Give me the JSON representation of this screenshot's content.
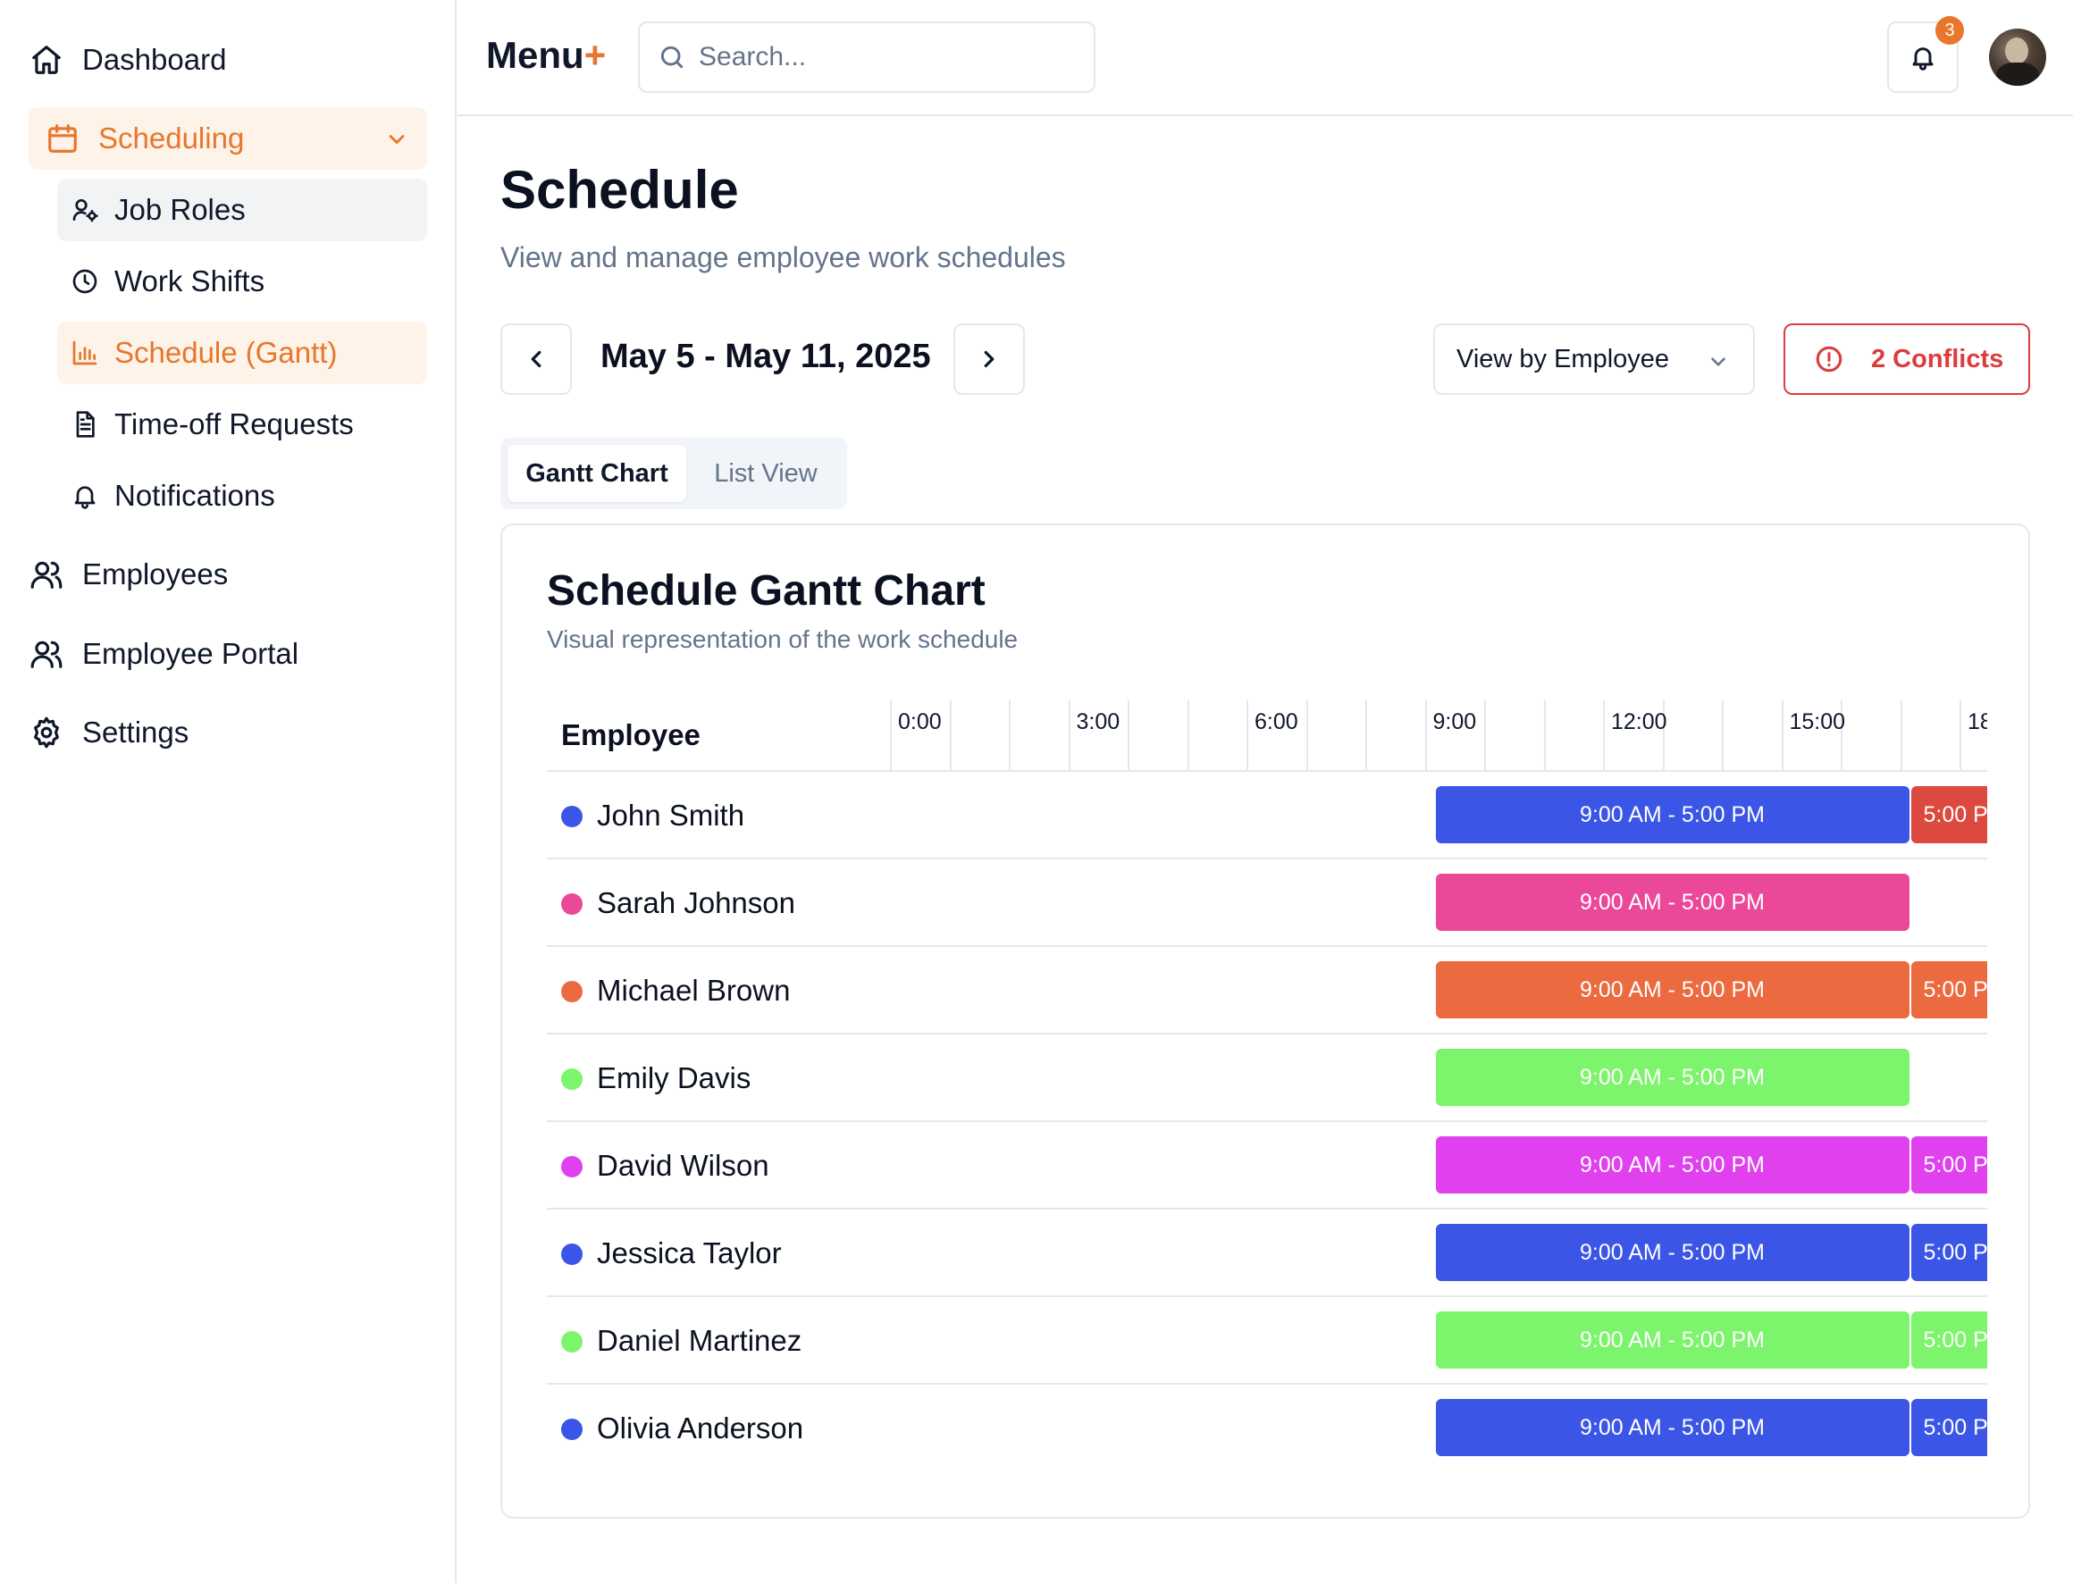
{
  "sidebar": {
    "items": [
      {
        "label": "Dashboard",
        "icon": "home-icon"
      },
      {
        "label": "Scheduling",
        "icon": "calendar-icon"
      },
      {
        "label": "Job Roles",
        "icon": "user-cog-icon"
      },
      {
        "label": "Work Shifts",
        "icon": "clock-icon"
      },
      {
        "label": "Schedule (Gantt)",
        "icon": "bar-chart-icon"
      },
      {
        "label": "Time-off Requests",
        "icon": "document-icon"
      },
      {
        "label": "Notifications",
        "icon": "bell-icon"
      },
      {
        "label": "Employees",
        "icon": "users-icon"
      },
      {
        "label": "Employee Portal",
        "icon": "users-icon"
      },
      {
        "label": "Settings",
        "icon": "gear-icon"
      }
    ]
  },
  "header": {
    "logo_text": "Menu",
    "logo_plus": "+",
    "search_placeholder": "Search...",
    "notification_count": "3"
  },
  "main": {
    "title": "Schedule",
    "subtitle": "View and manage employee work schedules",
    "date_range": "May 5 - May 11, 2025",
    "view_select": "View by Employee",
    "conflicts_label": "2 Conflicts",
    "tabs": [
      {
        "label": "Gantt Chart",
        "active": true
      },
      {
        "label": "List View",
        "active": false
      }
    ]
  },
  "gantt": {
    "title": "Schedule Gantt Chart",
    "subtitle": "Visual representation of the work schedule",
    "employee_header": "Employee",
    "hour_labels": [
      "0:00",
      "3:00",
      "6:00",
      "9:00",
      "12:00",
      "15:00",
      "18"
    ],
    "rows": [
      {
        "name": "John Smith",
        "color": "#3b55e6",
        "shift": "9:00 AM - 5:00 PM",
        "next_shift": "5:00 P",
        "next_color": "#dc4a3f"
      },
      {
        "name": "Sarah Johnson",
        "color": "#ec4899",
        "shift": "9:00 AM - 5:00 PM",
        "next_shift": "",
        "next_color": ""
      },
      {
        "name": "Michael Brown",
        "color": "#ec6a3f",
        "shift": "9:00 AM - 5:00 PM",
        "next_shift": "5:00 P",
        "next_color": "#ec6a3f"
      },
      {
        "name": "Emily Davis",
        "color": "#7cf46b",
        "shift": "9:00 AM - 5:00 PM",
        "next_shift": "",
        "next_color": ""
      },
      {
        "name": "David Wilson",
        "color": "#e040ee",
        "shift": "9:00 AM - 5:00 PM",
        "next_shift": "5:00 P",
        "next_color": "#e040ee"
      },
      {
        "name": "Jessica Taylor",
        "color": "#3b55e6",
        "shift": "9:00 AM - 5:00 PM",
        "next_shift": "5:00 P",
        "next_color": "#3b55e6"
      },
      {
        "name": "Daniel Martinez",
        "color": "#7cf46b",
        "shift": "9:00 AM - 5:00 PM",
        "next_shift": "5:00 P",
        "next_color": "#7cf46b"
      },
      {
        "name": "Olivia Anderson",
        "color": "#3b55e6",
        "shift": "9:00 AM - 5:00 PM",
        "next_shift": "5:00 P",
        "next_color": "#3b55e6"
      }
    ]
  },
  "colors": {
    "accent": "#e8762c",
    "danger": "#dc3c3c",
    "muted_text": "#64748b",
    "border": "#e5e7eb"
  }
}
